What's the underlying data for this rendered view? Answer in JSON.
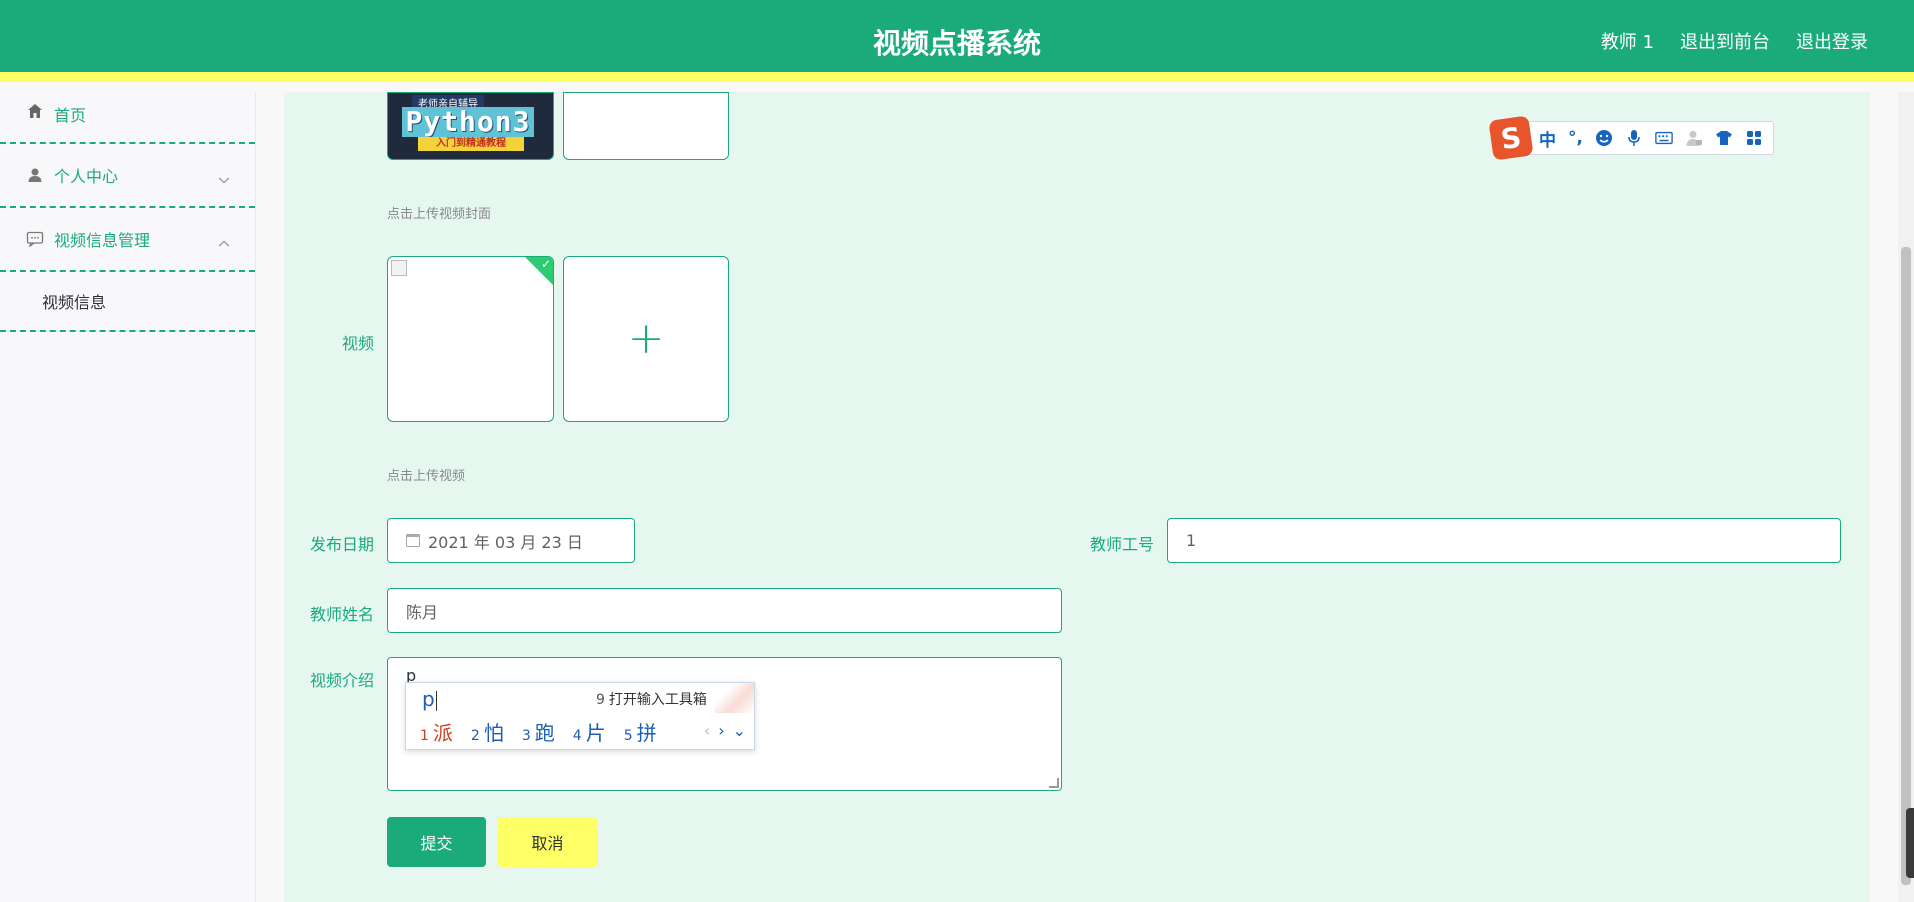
{
  "header": {
    "title": "视频点播系统",
    "nav": [
      "教师 1",
      "退出到前台",
      "退出登录"
    ]
  },
  "sidebar": {
    "items": [
      {
        "label": "首页",
        "icon": "home-icon"
      },
      {
        "label": "个人中心",
        "icon": "user-icon",
        "expanded": false
      },
      {
        "label": "视频信息管理",
        "icon": "message-icon",
        "expanded": true
      }
    ],
    "sub_items": [
      "视频信息"
    ]
  },
  "form": {
    "cover": {
      "hint": "点击上传视频封面",
      "preview_text": {
        "tag": "老师亲自辅导",
        "title": "Python3",
        "subtitle": "入门到精通教程"
      }
    },
    "video": {
      "label": "视频",
      "hint": "点击上传视频",
      "add_symbol": "+"
    },
    "publish_date": {
      "label": "发布日期",
      "value": "2021 年 03 月 23 日"
    },
    "teacher_id": {
      "label": "教师工号",
      "value": "1"
    },
    "teacher_name": {
      "label": "教师姓名",
      "value": "陈月"
    },
    "intro": {
      "label": "视频介绍",
      "value": "p"
    },
    "submit_label": "提交",
    "cancel_label": "取消"
  },
  "ime": {
    "composition": "p",
    "tool_num": "9",
    "tool_text": "打开输入工具箱",
    "candidates": [
      {
        "num": "1",
        "text": "派"
      },
      {
        "num": "2",
        "text": "怕"
      },
      {
        "num": "3",
        "text": "跑"
      },
      {
        "num": "4",
        "text": "片"
      },
      {
        "num": "5",
        "text": "拼"
      }
    ],
    "prev": "‹",
    "next": "›",
    "expand": "⌄"
  },
  "sogou_toolbar": {
    "logo": "S",
    "mode": "中",
    "punct": "°,"
  },
  "colors": {
    "primary": "#1bab7b",
    "accent": "#ffff66",
    "panel": "#e6f7f0"
  }
}
